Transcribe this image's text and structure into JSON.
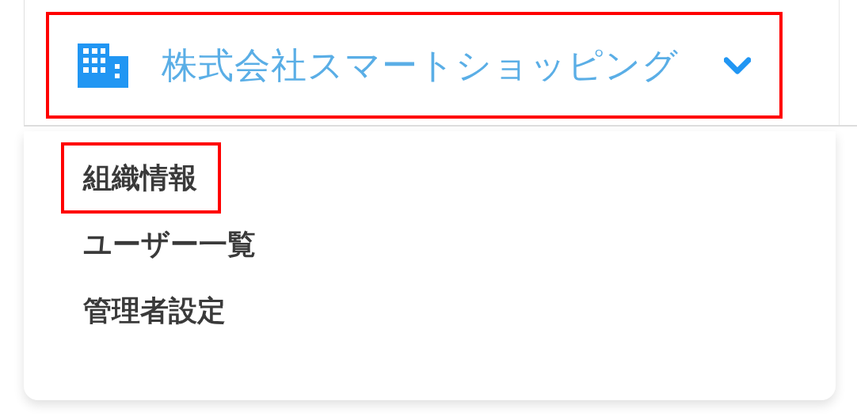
{
  "org_switcher": {
    "label": "株式会社スマートショッピング",
    "expanded": true,
    "highlighted": true
  },
  "menu": {
    "items": [
      {
        "label": "組織情報",
        "highlighted": true
      },
      {
        "label": "ユーザー一覧",
        "highlighted": false
      },
      {
        "label": "管理者設定",
        "highlighted": false
      }
    ]
  }
}
